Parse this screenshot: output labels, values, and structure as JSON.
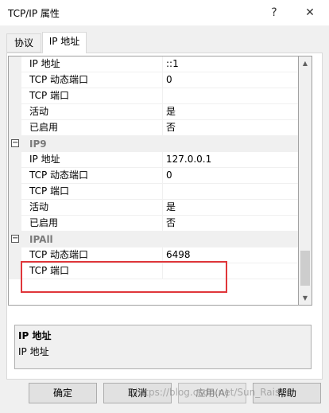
{
  "window": {
    "title": "TCP/IP 属性",
    "help_glyph": "?",
    "close_glyph": "✕"
  },
  "tabs": [
    {
      "label": "协议"
    },
    {
      "label": "IP 地址"
    }
  ],
  "grid": {
    "rows": [
      {
        "kind": "prop",
        "name": "IP 地址",
        "value": "::1"
      },
      {
        "kind": "prop",
        "name": "TCP 动态端口",
        "value": "0"
      },
      {
        "kind": "prop",
        "name": "TCP 端口",
        "value": ""
      },
      {
        "kind": "prop",
        "name": "活动",
        "value": "是"
      },
      {
        "kind": "prop",
        "name": "已启用",
        "value": "否"
      },
      {
        "kind": "cat",
        "name": "IP9",
        "value": "",
        "expander": "⊟"
      },
      {
        "kind": "prop",
        "name": "IP 地址",
        "value": "127.0.0.1"
      },
      {
        "kind": "prop",
        "name": "TCP 动态端口",
        "value": "0"
      },
      {
        "kind": "prop",
        "name": "TCP 端口",
        "value": ""
      },
      {
        "kind": "prop",
        "name": "活动",
        "value": "是"
      },
      {
        "kind": "prop",
        "name": "已启用",
        "value": "否"
      },
      {
        "kind": "cat",
        "name": "IPAll",
        "value": "",
        "expander": "⊟"
      },
      {
        "kind": "prop",
        "name": "TCP 动态端口",
        "value": "6498"
      },
      {
        "kind": "prop",
        "name": "TCP 端口",
        "value": ""
      }
    ]
  },
  "description": {
    "title": "IP 地址",
    "text": "IP 地址"
  },
  "buttons": {
    "ok": "确定",
    "cancel": "取消",
    "apply": "应用(A)",
    "help": "帮助"
  },
  "watermark": "https://blog.csdn.net/Sun_Raiser",
  "colors": {
    "highlight_box": "#e0363a",
    "category_text": "#7a7a7a"
  }
}
